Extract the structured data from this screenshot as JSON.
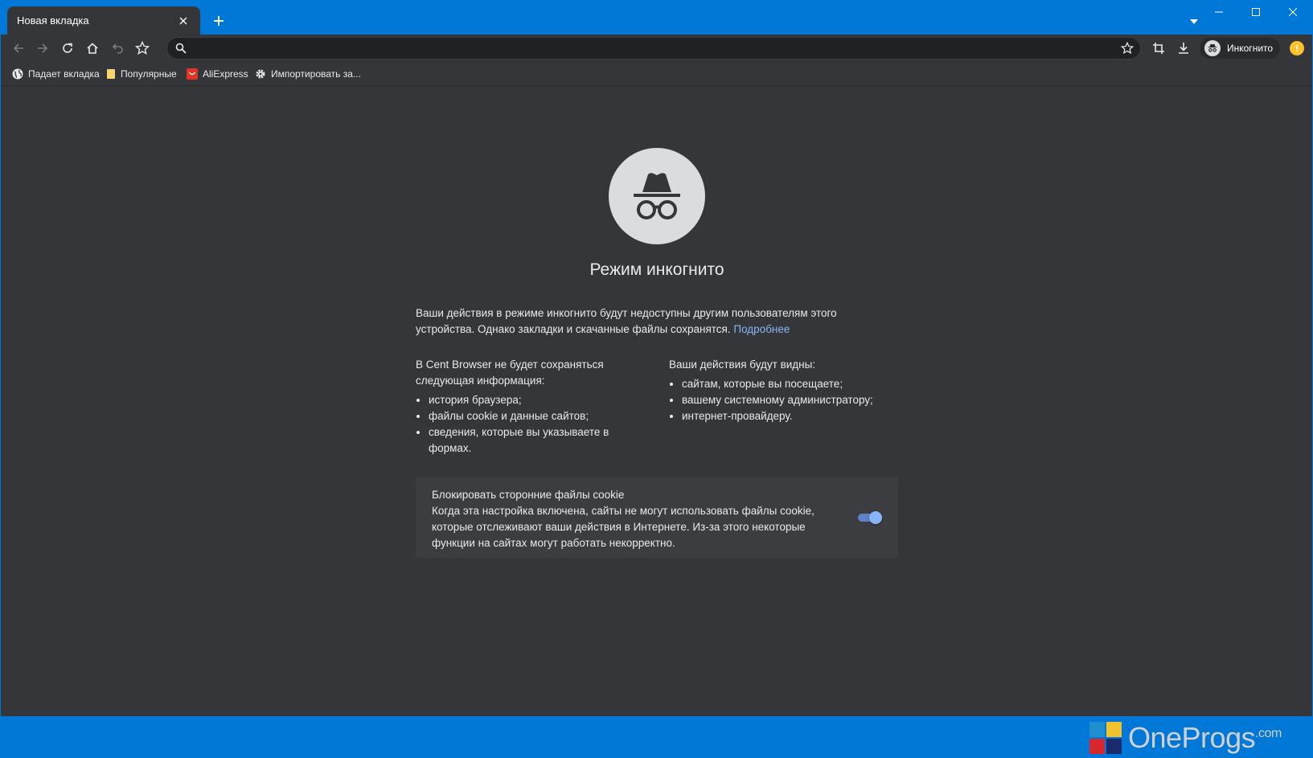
{
  "tab": {
    "title": "Новая вкладка"
  },
  "omnibox": {
    "value": "",
    "placeholder": ""
  },
  "profile": {
    "label": "Инкогнито"
  },
  "bookmarks": [
    {
      "label": "Падает вкладка",
      "icon": "globe-icon"
    },
    {
      "label": "Популярные",
      "icon": "folder-icon"
    },
    {
      "label": "AliExpress",
      "icon": "aliexpress-icon"
    },
    {
      "label": "Импортировать за...",
      "icon": "gear-icon"
    }
  ],
  "page": {
    "title": "Режим инкогнито",
    "intro": "Ваши действия в режиме инкогнито будут недоступны другим пользователям этого устройства. Однако закладки и скачанные файлы сохранятся.",
    "learn_more": "Подробнее",
    "left_heading": "В Cent Browser не будет сохраняться следующая информация:",
    "left_items": [
      "история браузера;",
      "файлы cookie и данные сайтов;",
      "сведения, которые вы указываете в формах."
    ],
    "right_heading": "Ваши действия будут видны:",
    "right_items": [
      "сайтам, которые вы посещаете;",
      "вашему системному администратору;",
      "интернет-провайдеру."
    ],
    "cookie_title": "Блокировать сторонние файлы cookie",
    "cookie_desc": "Когда эта настройка включена, сайты не могут использовать файлы cookie, которые отслеживают ваши действия в Интернете. Из-за этого некоторые функции на сайтах могут работать некорректно.",
    "cookie_toggle_on": true
  },
  "watermark": {
    "text": "OneProgs",
    "suffix": ".com"
  },
  "colors": {
    "titlebar": "#0078d7",
    "background": "#35363a",
    "link": "#8ab4f8",
    "toggle": "#8ab4f8"
  }
}
